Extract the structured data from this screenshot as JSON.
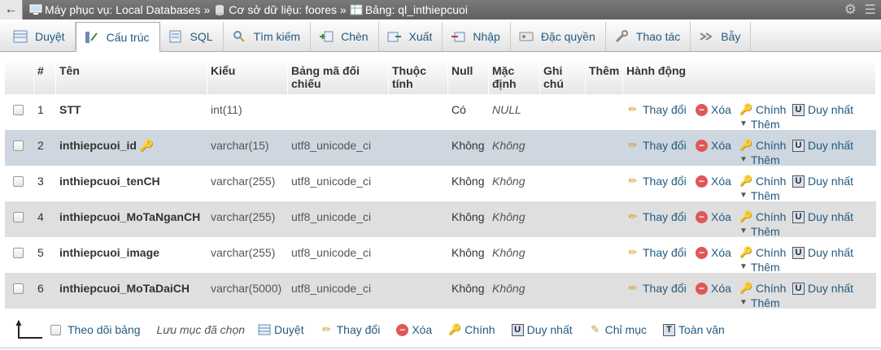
{
  "breadcrumb": {
    "server": "Máy phục vụ: Local Databases",
    "database": "Cơ sở dữ liệu: foores",
    "table": "Bảng: ql_inthiepcuoi",
    "separator": "»"
  },
  "tabs": [
    {
      "label": "Duyệt",
      "icon": "browse-icon"
    },
    {
      "label": "Cấu trúc",
      "icon": "structure-icon",
      "active": true
    },
    {
      "label": "SQL",
      "icon": "sql-icon"
    },
    {
      "label": "Tìm kiếm",
      "icon": "search-icon"
    },
    {
      "label": "Chèn",
      "icon": "insert-icon"
    },
    {
      "label": "Xuất",
      "icon": "export-icon"
    },
    {
      "label": "Nhập",
      "icon": "import-icon"
    },
    {
      "label": "Đặc quyền",
      "icon": "privileges-icon"
    },
    {
      "label": "Thao tác",
      "icon": "operations-icon"
    },
    {
      "label": "Bẫy",
      "icon": "triggers-icon"
    }
  ],
  "table": {
    "headers": {
      "num": "#",
      "name": "Tên",
      "type": "Kiểu",
      "collation": "Bảng mã đối chiếu",
      "attributes": "Thuộc tính",
      "null": "Null",
      "default": "Mặc định",
      "comments": "Ghi chú",
      "extra": "Thêm",
      "action": "Hành động"
    },
    "rows": [
      {
        "num": "1",
        "name": "STT",
        "type": "int(11)",
        "collation": "",
        "null": "Có",
        "default": "NULL"
      },
      {
        "num": "2",
        "name": "inthiepcuoi_id",
        "type": "varchar(15)",
        "collation": "utf8_unicode_ci",
        "null": "Không",
        "default": "Không"
      },
      {
        "num": "3",
        "name": "inthiepcuoi_tenCH",
        "type": "varchar(255)",
        "collation": "utf8_unicode_ci",
        "null": "Không",
        "default": "Không"
      },
      {
        "num": "4",
        "name": "inthiepcuoi_MoTaNganCH",
        "type": "varchar(255)",
        "collation": "utf8_unicode_ci",
        "null": "Không",
        "default": "Không"
      },
      {
        "num": "5",
        "name": "inthiepcuoi_image",
        "type": "varchar(255)",
        "collation": "utf8_unicode_ci",
        "null": "Không",
        "default": "Không"
      },
      {
        "num": "6",
        "name": "inthiepcuoi_MoTaDaiCH",
        "type": "varchar(5000)",
        "collation": "utf8_unicode_ci",
        "null": "Không",
        "default": "Không"
      }
    ],
    "actions": {
      "change": "Thay đổi",
      "drop": "Xóa",
      "primary": "Chính",
      "unique": "Duy nhất",
      "more": "Thêm"
    }
  },
  "footer": {
    "check_all": "Theo dõi bảng",
    "with_selected": "Lưu mục đã chọn",
    "browse": "Duyệt",
    "change": "Thay đổi",
    "drop": "Xóa",
    "primary": "Chính",
    "unique": "Duy nhất",
    "index": "Chỉ mục",
    "fulltext": "Toàn văn"
  }
}
